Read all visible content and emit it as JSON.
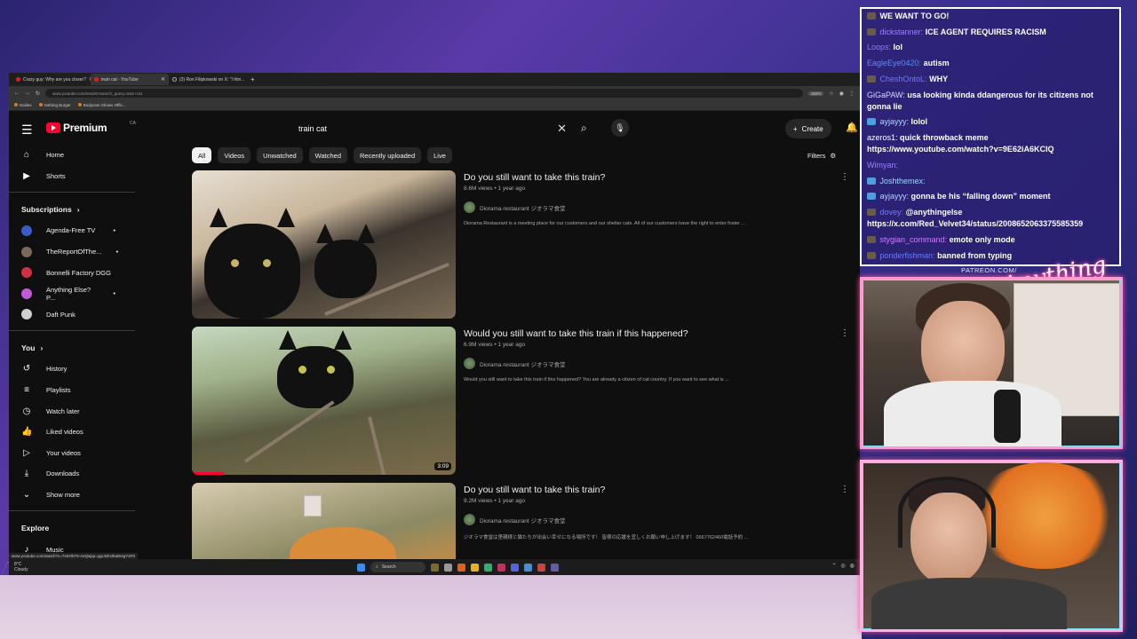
{
  "browser": {
    "tabs": [
      {
        "label": "Crazy guy: Why are you closer?",
        "active": false
      },
      {
        "label": "train cat - YouTube",
        "active": true
      },
      {
        "label": "(3) Ron Filipkowski on X: \"I thin...",
        "active": false
      }
    ],
    "url": "www.youtube.com/results?search_query=train+cat",
    "zoom": "150%",
    "bookmarks": [
      "Dailies",
      "Nothing Burger",
      "Bodycam Shows Offic..."
    ],
    "status_url": "www.youtube.com/watch?v=7sEOkT9-AeQ&pp=ygUIdHJhaW4gY2F0"
  },
  "youtube": {
    "logo_text": "Premium",
    "logo_region": "CA",
    "search_value": "train cat",
    "create_label": "Create",
    "filters_label": "Filters",
    "chips": [
      "All",
      "Videos",
      "Unwatched",
      "Watched",
      "Recently uploaded",
      "Live"
    ],
    "sidebar": {
      "main": [
        {
          "label": "Home",
          "icon": "home-icon"
        },
        {
          "label": "Shorts",
          "icon": "shorts-icon"
        }
      ],
      "subscriptions_title": "Subscriptions",
      "subscriptions": [
        {
          "label": "Agenda-Free TV",
          "color": "#3a5cc8"
        },
        {
          "label": "TheReportOfThe...",
          "color": "#7a6a5a"
        },
        {
          "label": "Bonnelli Factory DGG",
          "color": "#d03040"
        },
        {
          "label": "Anything Else? P...",
          "color": "#c05ad8"
        },
        {
          "label": "Daft Punk",
          "color": "#d0d0d0"
        }
      ],
      "you_title": "You",
      "you_items": [
        {
          "label": "History",
          "icon": "history-icon"
        },
        {
          "label": "Playlists",
          "icon": "playlists-icon"
        },
        {
          "label": "Watch later",
          "icon": "clock-icon"
        },
        {
          "label": "Liked videos",
          "icon": "thumbs-up-icon"
        },
        {
          "label": "Your videos",
          "icon": "video-icon"
        },
        {
          "label": "Downloads",
          "icon": "download-icon"
        },
        {
          "label": "Show more",
          "icon": "chevron-down-icon"
        }
      ],
      "explore_title": "Explore",
      "explore_items": [
        {
          "label": "Music",
          "icon": "music-icon"
        }
      ]
    },
    "results": [
      {
        "title": "Do you still want to take this train?",
        "meta": "8.6M views • 1 year ago",
        "channel": "Diorama restaurant ジオラマ食堂",
        "description": "Diorama Restaurant is a meeting place for our customers and our shelter cats. All of our customers have the right to enter foster ...",
        "duration": ""
      },
      {
        "title": "Would you still want to take this train if this happened?",
        "meta": "6.9M views • 1 year ago",
        "channel": "Diorama restaurant ジオラマ食堂",
        "description": "Would you still want to take this train if this happened? You are already a citizen of cat country. If you want to see what is ...",
        "duration": "3:09"
      },
      {
        "title": "Do you still want to take this train?",
        "meta": "9.2M views • 1 year ago",
        "channel": "Diorama restaurant ジオラマ食堂",
        "description": "ジオラマ食堂は里親様と猫たちが出会い幸せになる場所です！ 皆様の応援を宜しくお願い申し上げます！ 0667762460電話予約 ...",
        "duration": ""
      }
    ]
  },
  "taskbar": {
    "weather_temp": "8°C",
    "weather_desc": "Cloudy",
    "search_label": "Search"
  },
  "chat": {
    "messages": [
      {
        "user": "",
        "text": "WE WANT TO GO!",
        "color": "#ffffff"
      },
      {
        "user": "dickstanner:",
        "text": "ICE AGENT REQUIRES RACISM",
        "color": "#a080ff"
      },
      {
        "user": "Loops:",
        "text": "lol",
        "color": "#8a7cff"
      },
      {
        "user": "EagleEye0420:",
        "text": "autism",
        "color": "#5a8cff"
      },
      {
        "user": "CheshOntoL:",
        "text": "WHY",
        "color": "#6a7cff"
      },
      {
        "user": "GiGaPAW:",
        "text": "usa looking kinda ddangerous for its citizens not gonna lie",
        "color": "#d8d8ff"
      },
      {
        "user": "ayjayyy:",
        "text": "lolol",
        "color": "#b0d8ff"
      },
      {
        "user": "azeros1:",
        "text": "quick throwback meme https://www.youtube.com/watch?v=9E62iA6KCIQ",
        "color": "#ffffff"
      },
      {
        "user": "Wimyan:",
        "text": "",
        "color": "#9a80ff"
      },
      {
        "user": "Joshthemex:",
        "text": "",
        "color": "#a0d8ff"
      },
      {
        "user": "ayjayyy:",
        "text": "gonna be his “falling down” moment",
        "color": "#b0d8ff"
      },
      {
        "user": "dovey:",
        "text": "@anythingelse https://x.com/Red_Velvet34/status/2008652063375585359",
        "color": "#6a7cff"
      },
      {
        "user": "stygian_command:",
        "text": "emote only mode",
        "color": "#d07cff"
      },
      {
        "user": "ponderfishman:",
        "text": "banned from typing",
        "color": "#6a7cff"
      }
    ],
    "patreon_label": "PATREON.COM/",
    "brand_script": "Anything Else?"
  }
}
